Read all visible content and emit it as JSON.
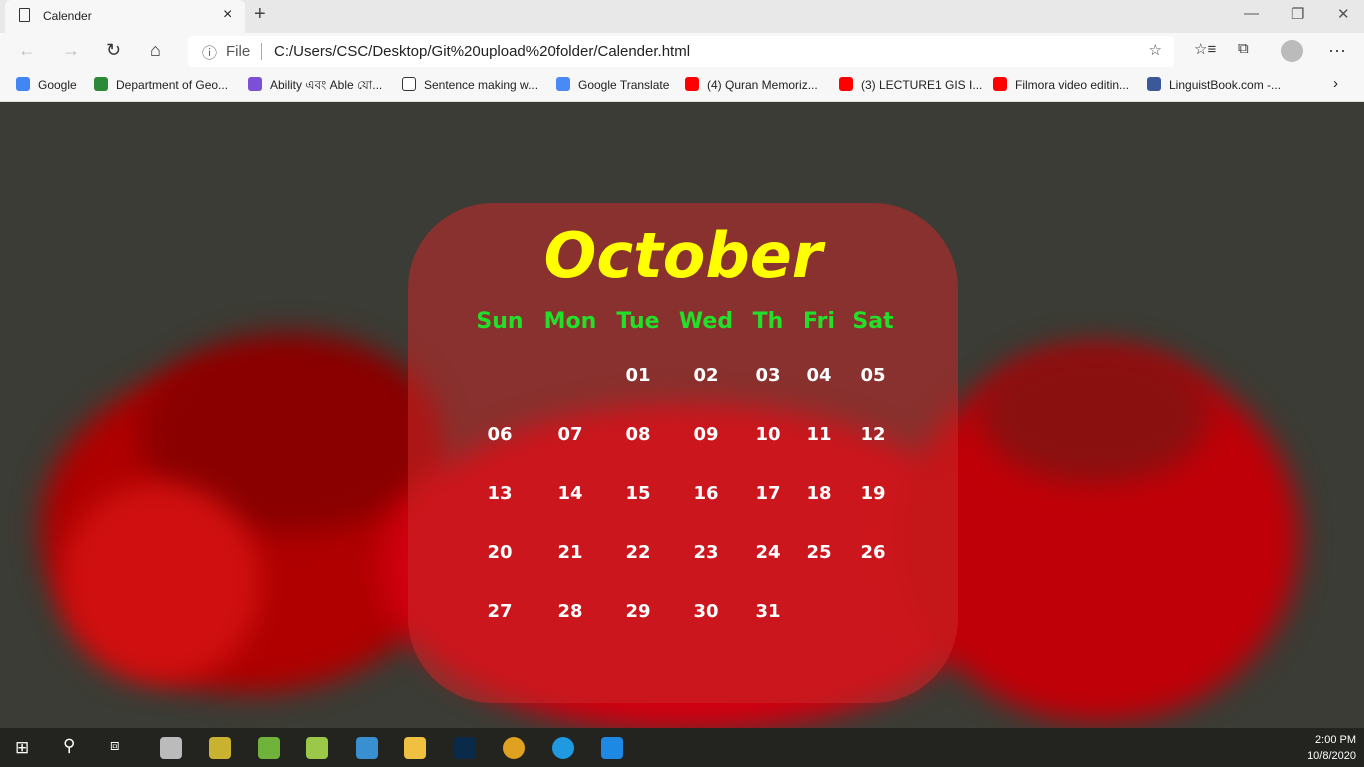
{
  "browser": {
    "tab_title": "Calender",
    "address_prefix": "File",
    "url": "C:/Users/CSC/Desktop/Git%20upload%20folder/Calender.html",
    "bookmarks": [
      {
        "label": "Google",
        "color": "#4285f4"
      },
      {
        "label": "Department of Geo...",
        "color": "#2a8a3a"
      },
      {
        "label": "Ability এবং Able যো...",
        "color": "#7b4fd6"
      },
      {
        "label": "Sentence making w...",
        "color": "#ffffff"
      },
      {
        "label": "Google Translate",
        "color": "#4a8af4"
      },
      {
        "label": "(4) Quran Memoriz...",
        "color": "#ff0000"
      },
      {
        "label": "(3) LECTURE1 GIS I...",
        "color": "#ff0000"
      },
      {
        "label": "Filmora video editin...",
        "color": "#ff0000"
      },
      {
        "label": "LinguistBook.com -...",
        "color": "#3b5998"
      }
    ]
  },
  "calendar": {
    "month": "October",
    "weekdays": [
      "Sun",
      "Mon",
      "Tue",
      "Wed",
      "Th",
      "Fri",
      "Sat"
    ],
    "weeks": [
      [
        "",
        "",
        "01",
        "02",
        "03",
        "04",
        "05"
      ],
      [
        "06",
        "07",
        "08",
        "09",
        "10",
        "11",
        "12"
      ],
      [
        "13",
        "14",
        "15",
        "16",
        "17",
        "18",
        "19"
      ],
      [
        "20",
        "21",
        "22",
        "23",
        "24",
        "25",
        "26"
      ],
      [
        "27",
        "28",
        "29",
        "30",
        "31",
        "",
        ""
      ]
    ],
    "colors": {
      "month": "#ffff00",
      "weekday": "#22e02a",
      "day": "#ffffff"
    }
  },
  "taskbar": {
    "time": "2:00 PM",
    "date": "10/8/2020",
    "apps": [
      {
        "name": "inkscape",
        "color": "#bbb"
      },
      {
        "name": "archive",
        "color": "#c9b230"
      },
      {
        "name": "qgis",
        "color": "#6fb33a"
      },
      {
        "name": "notepad",
        "color": "#9cc84a"
      },
      {
        "name": "search-tool",
        "color": "#3a8fd0"
      },
      {
        "name": "file-explorer",
        "color": "#f0c040"
      },
      {
        "name": "photoshop",
        "color": "#0a2a4a"
      },
      {
        "name": "chrome",
        "color": "#e0a020"
      },
      {
        "name": "edge",
        "color": "#1f9ae0"
      },
      {
        "name": "vscode",
        "color": "#1e88e5"
      }
    ]
  }
}
